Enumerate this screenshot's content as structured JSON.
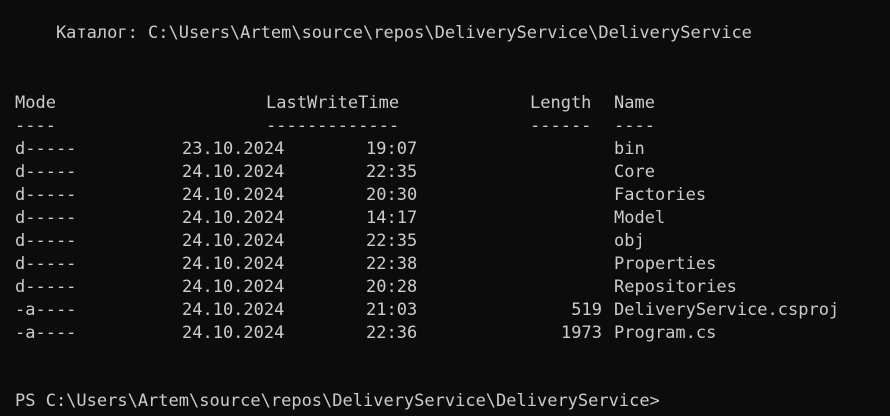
{
  "directory_line": "    Каталог: C:\\Users\\Artem\\source\\repos\\DeliveryService\\DeliveryService",
  "headers": {
    "mode": "Mode",
    "lastwritetime": "LastWriteTime",
    "length": "Length",
    "name": "Name"
  },
  "underlines": {
    "mode": "----",
    "lastwritetime": "-------------",
    "length": "------",
    "name": "----"
  },
  "rows": [
    {
      "mode": "d-----",
      "date": "23.10.2024",
      "time": "19:07",
      "length": "",
      "name": "bin"
    },
    {
      "mode": "d-----",
      "date": "24.10.2024",
      "time": "22:35",
      "length": "",
      "name": "Core"
    },
    {
      "mode": "d-----",
      "date": "24.10.2024",
      "time": "20:30",
      "length": "",
      "name": "Factories"
    },
    {
      "mode": "d-----",
      "date": "24.10.2024",
      "time": "14:17",
      "length": "",
      "name": "Model"
    },
    {
      "mode": "d-----",
      "date": "24.10.2024",
      "time": "22:35",
      "length": "",
      "name": "obj"
    },
    {
      "mode": "d-----",
      "date": "24.10.2024",
      "time": "22:38",
      "length": "",
      "name": "Properties"
    },
    {
      "mode": "d-----",
      "date": "24.10.2024",
      "time": "20:28",
      "length": "",
      "name": "Repositories"
    },
    {
      "mode": "-a----",
      "date": "24.10.2024",
      "time": "21:03",
      "length": "519",
      "name": "DeliveryService.csproj"
    },
    {
      "mode": "-a----",
      "date": "24.10.2024",
      "time": "22:36",
      "length": "1973",
      "name": "Program.cs"
    }
  ],
  "prompt": "PS C:\\Users\\Artem\\source\\repos\\DeliveryService\\DeliveryService>",
  "colors": {
    "background": "#0c0c0c",
    "text": "#cccccc"
  }
}
